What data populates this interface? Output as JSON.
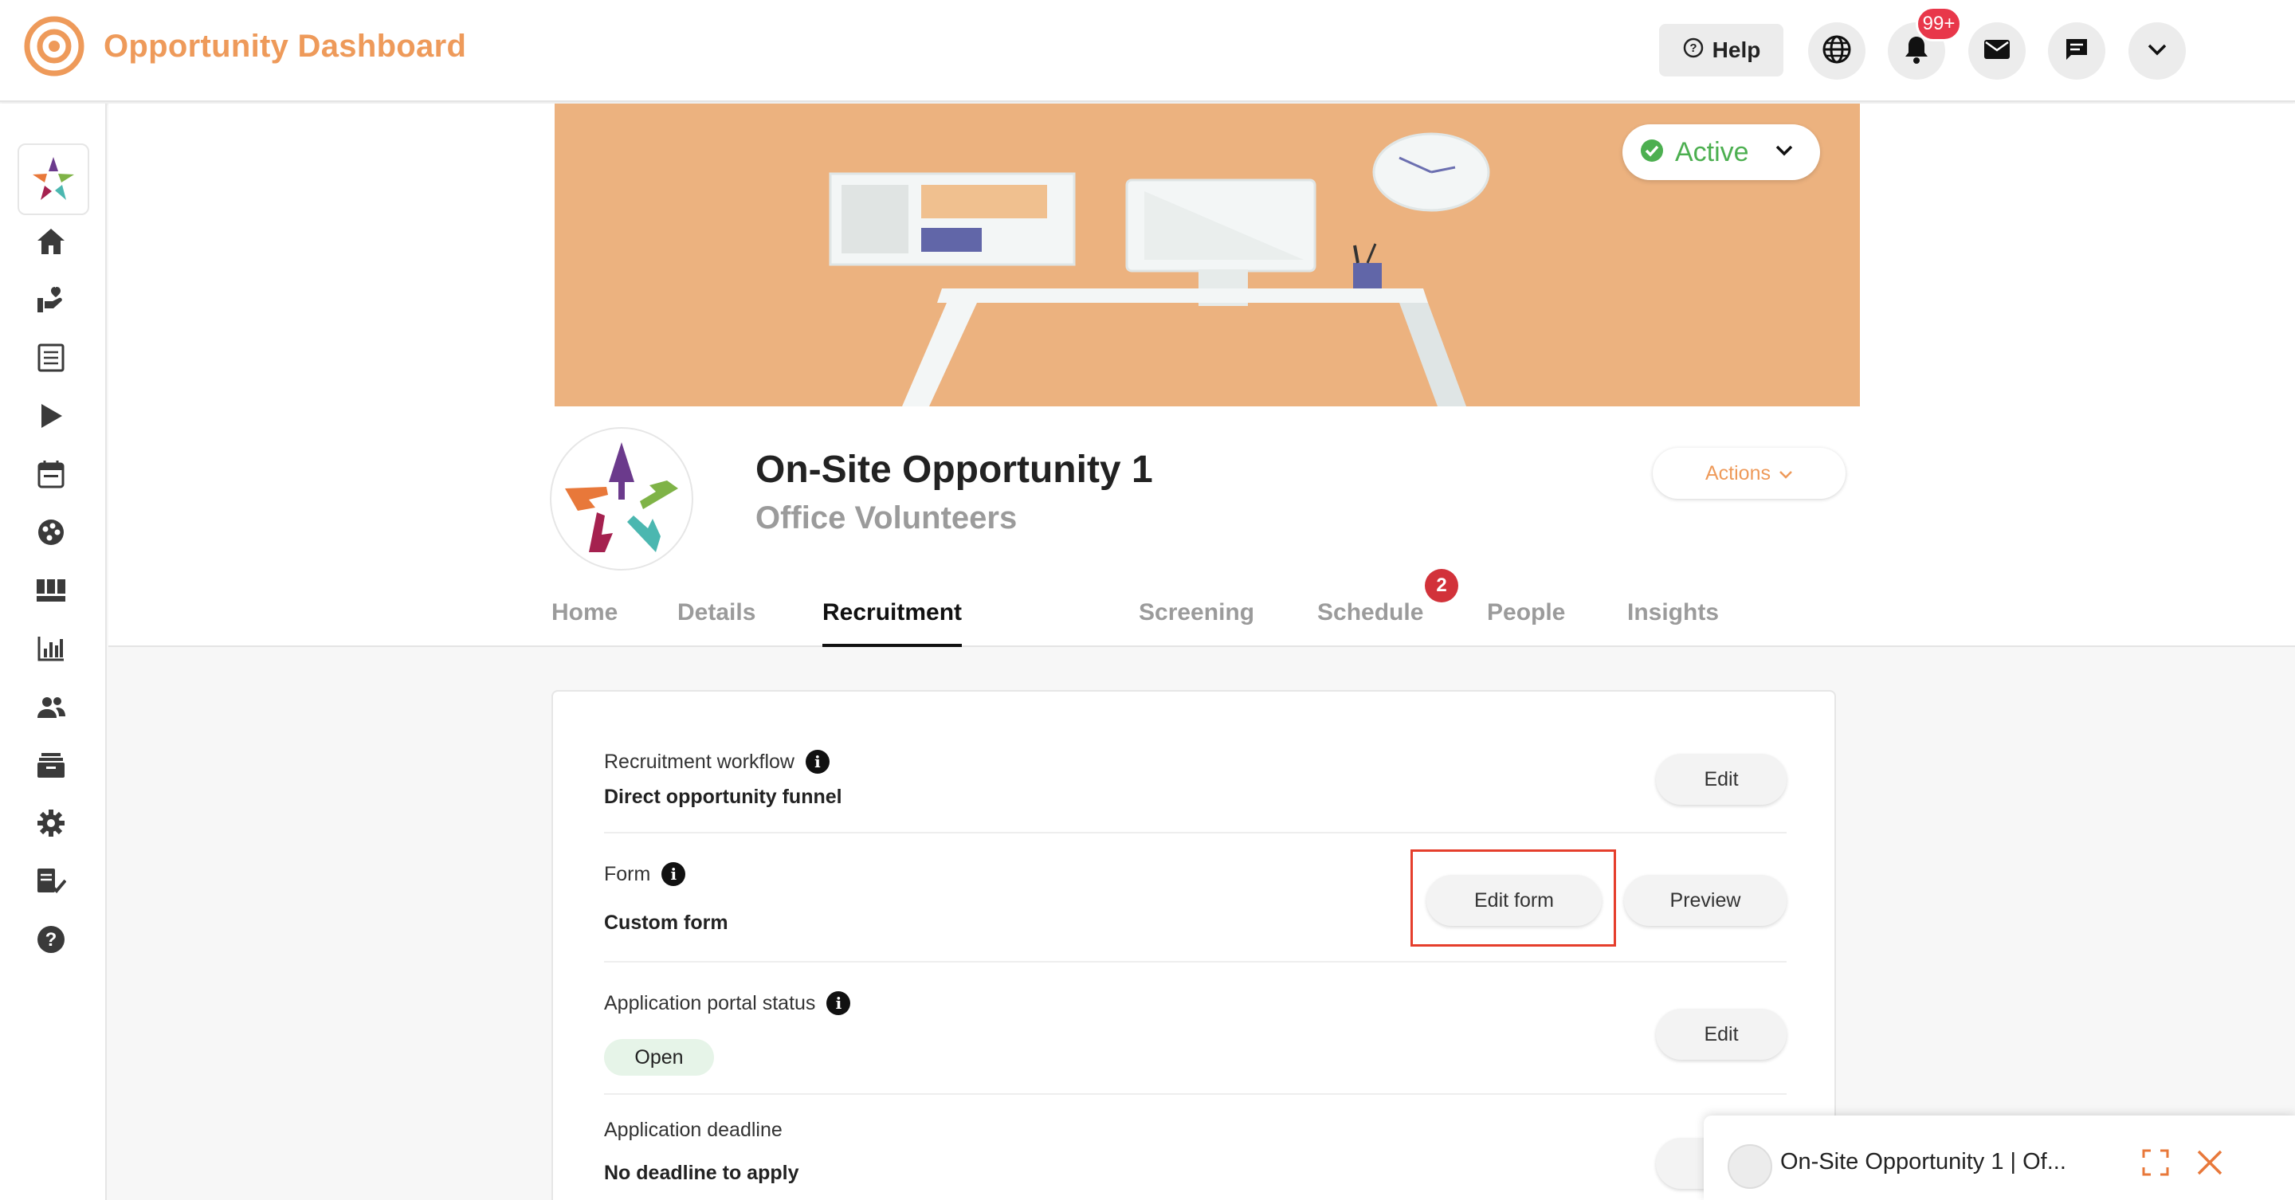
{
  "app": {
    "title": "Opportunity Dashboard"
  },
  "topbar": {
    "help_label": "Help",
    "notification_count": "99+",
    "icons": [
      "globe-icon",
      "bell-icon",
      "mail-icon",
      "chat-icon",
      "chevron-down-icon"
    ]
  },
  "sidebar": {
    "icons": [
      "home-icon",
      "volunteer-hand-icon",
      "checklist-icon",
      "play-icon",
      "calendar-icon",
      "palette-icon",
      "board-icon",
      "bar-chart-icon",
      "people-icon",
      "archive-icon",
      "gear-icon",
      "approval-icon",
      "help-circle-icon"
    ]
  },
  "banner": {
    "status_label": "Active",
    "accent_color": "#ecb27f"
  },
  "opportunity": {
    "title": "On-Site Opportunity 1",
    "subtitle": "Office Volunteers",
    "actions_label": "Actions"
  },
  "tabs": [
    {
      "label": "Home"
    },
    {
      "label": "Details"
    },
    {
      "label": "Recruitment",
      "active": true
    },
    {
      "label": "Screening"
    },
    {
      "label": "Schedule",
      "badge": "2"
    },
    {
      "label": "People"
    },
    {
      "label": "Insights"
    }
  ],
  "recruitment": {
    "workflow": {
      "label": "Recruitment workflow",
      "value": "Direct opportunity funnel",
      "edit_label": "Edit"
    },
    "form": {
      "label": "Form",
      "value": "Custom form",
      "edit_form_label": "Edit form",
      "preview_label": "Preview"
    },
    "portal_status": {
      "label": "Application portal status",
      "value": "Open",
      "edit_label": "Edit"
    },
    "deadline": {
      "label": "Application deadline",
      "value": "No deadline to apply"
    }
  },
  "popup": {
    "title": "On-Site Opportunity 1 | Of..."
  }
}
